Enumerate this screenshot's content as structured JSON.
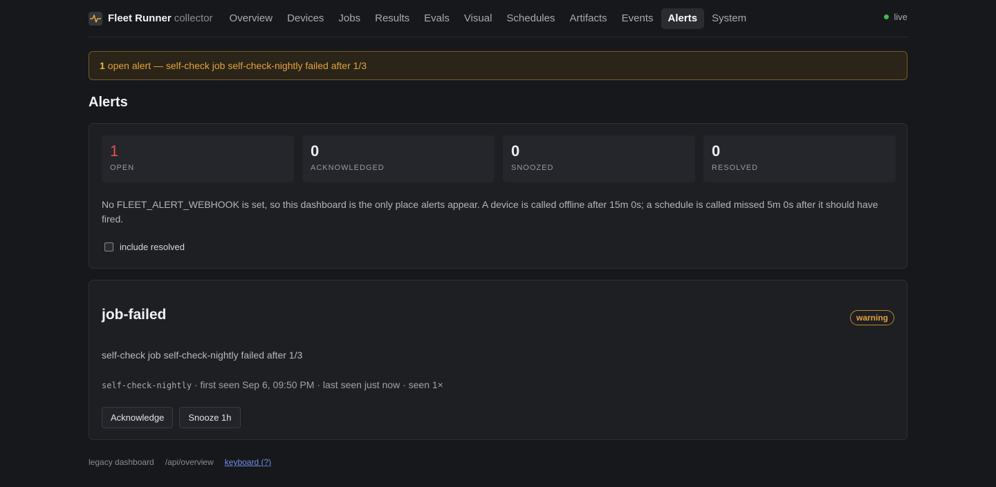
{
  "brand": {
    "name": "Fleet Runner",
    "sub": "collector",
    "icon": "pulse-icon"
  },
  "nav": {
    "items": [
      "Overview",
      "Devices",
      "Jobs",
      "Results",
      "Evals",
      "Visual",
      "Schedules",
      "Artifacts",
      "Events",
      "Alerts",
      "System"
    ],
    "active": "Alerts"
  },
  "status": {
    "label": "live",
    "color": "#3fb950"
  },
  "banner": {
    "count": "1",
    "text": "open alert — self-check job self-check-nightly failed after 1/3"
  },
  "page": {
    "title": "Alerts"
  },
  "stats": [
    {
      "value": "1",
      "label": "OPEN"
    },
    {
      "value": "0",
      "label": "ACKNOWLEDGED"
    },
    {
      "value": "0",
      "label": "SNOOZED"
    },
    {
      "value": "0",
      "label": "RESOLVED"
    }
  ],
  "note": "No FLEET_ALERT_WEBHOOK is set, so this dashboard is the only place alerts appear. A device is called offline after 15m 0s; a schedule is called missed 5m 0s after it should have fired.",
  "filter": {
    "include_resolved_label": "include resolved",
    "checked": false
  },
  "alert": {
    "title": "job-failed",
    "severity": "warning",
    "message": "self-check job self-check-nightly failed after 1/3",
    "meta_code": "self-check-nightly",
    "meta_text": " · first seen Sep 6, 09:50 PM · last seen just now · seen 1×",
    "acknowledge_label": "Acknowledge",
    "snooze_label": "Snooze 1h"
  },
  "footer": {
    "legacy": "legacy dashboard",
    "api": "/api/overview",
    "keyboard": "keyboard (?)"
  },
  "colors": {
    "accent_warning": "#e3a33b",
    "open_red": "#e5534b"
  }
}
